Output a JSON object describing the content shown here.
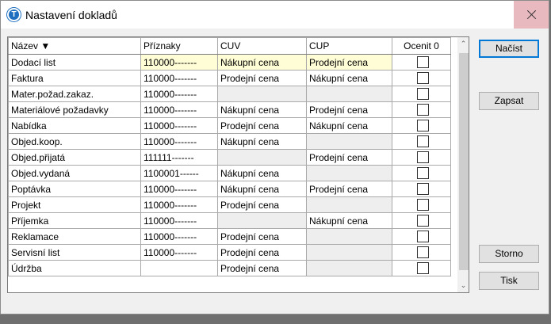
{
  "window": {
    "title": "Nastavení dokladů"
  },
  "grid": {
    "columns": [
      "Název ▼",
      "Příznaky",
      "CUV",
      "CUP",
      "Ocenit 0"
    ],
    "rows": [
      {
        "name": "Dodací list",
        "flags": "110000-------",
        "cuv": "Nákupní cena",
        "cup": "Prodejní cena",
        "ocenit": false
      },
      {
        "name": "Faktura",
        "flags": "110000-------",
        "cuv": "Prodejní cena",
        "cup": "Nákupní cena",
        "ocenit": false
      },
      {
        "name": "Mater.požad.zakaz.",
        "flags": "110000-------",
        "cuv": "",
        "cup": "",
        "ocenit": false
      },
      {
        "name": "Materiálové požadavky",
        "flags": "110000-------",
        "cuv": "Nákupní cena",
        "cup": "Prodejní cena",
        "ocenit": false
      },
      {
        "name": "Nabídka",
        "flags": "110000-------",
        "cuv": "Prodejní cena",
        "cup": "Nákupní cena",
        "ocenit": false
      },
      {
        "name": "Objed.koop.",
        "flags": "110000-------",
        "cuv": "Nákupní cena",
        "cup": "",
        "ocenit": false
      },
      {
        "name": "Objed.přijatá",
        "flags": "111111-------",
        "cuv": "",
        "cup": "Prodejní cena",
        "ocenit": false
      },
      {
        "name": "Objed.vydaná",
        "flags": "1100001------",
        "cuv": "Nákupní cena",
        "cup": "",
        "ocenit": false
      },
      {
        "name": "Poptávka",
        "flags": "110000-------",
        "cuv": "Nákupní cena",
        "cup": "Prodejní cena",
        "ocenit": false
      },
      {
        "name": "Projekt",
        "flags": "110000-------",
        "cuv": "Prodejní cena",
        "cup": "",
        "ocenit": false
      },
      {
        "name": "Příjemka",
        "flags": "110000-------",
        "cuv": "",
        "cup": "Nákupní cena",
        "ocenit": false
      },
      {
        "name": "Reklamace",
        "flags": "110000-------",
        "cuv": "Prodejní cena",
        "cup": "",
        "ocenit": false
      },
      {
        "name": "Servisní list",
        "flags": "110000-------",
        "cuv": "Prodejní cena",
        "cup": "",
        "ocenit": false
      },
      {
        "name": "Údržba",
        "flags": "",
        "cuv": "Prodejní cena",
        "cup": "",
        "ocenit": false
      }
    ],
    "selected_row": 0,
    "scroll_up_glyph": "⌃",
    "scroll_down_glyph": "⌄"
  },
  "buttons": {
    "load": "Načíst",
    "write": "Zapsat",
    "cancel": "Storno",
    "print": "Tisk"
  },
  "colors": {
    "selected_row": "#fffdd6",
    "close_hover": "#e8b9bf",
    "default_button_border": "#0078d7"
  },
  "icons": {
    "app": "app-logo-icon",
    "close": "close-icon"
  }
}
